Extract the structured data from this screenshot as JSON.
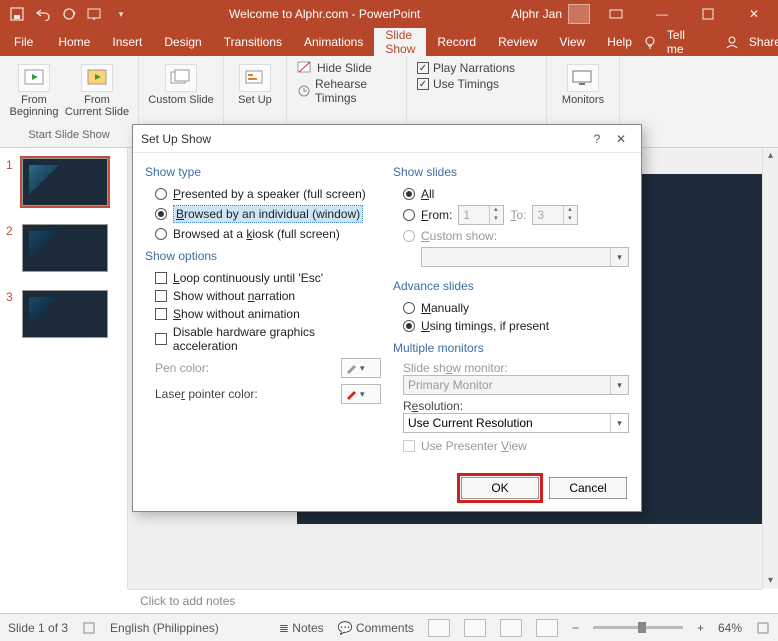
{
  "titlebar": {
    "doc_title": "Welcome to Alphr.com - PowerPoint",
    "user": "Alphr Jan"
  },
  "ribbon": {
    "tabs": [
      "File",
      "Home",
      "Insert",
      "Design",
      "Transitions",
      "Animations",
      "Slide Show",
      "Record",
      "Review",
      "View",
      "Help"
    ],
    "active": "Slide Show",
    "tell_me": "Tell me",
    "share": "Share",
    "group_start": "Start Slide Show",
    "from_beginning": "From\nBeginning",
    "from_current": "From\nCurrent Slide",
    "custom_slide": "Custom Slide",
    "setup": "Set Up",
    "hide_slide": "Hide Slide",
    "rehearse": "Rehearse Timings",
    "play_narr": "Play Narrations",
    "use_timings": "Use Timings",
    "monitors": "Monitors"
  },
  "dlg": {
    "title": "Set Up Show",
    "show_type": "Show type",
    "presented": "Presented by a speaker (full screen)",
    "browsed_ind": "Browsed by an individual (window)",
    "browsed_kiosk": "Browsed at a kiosk (full screen)",
    "show_options": "Show options",
    "loop": "Loop continuously until 'Esc'",
    "no_narr": "Show without narration",
    "no_anim": "Show without animation",
    "disable_hw": "Disable hardware graphics acceleration",
    "pen_color": "Pen color:",
    "laser_color": "Laser pointer color:",
    "show_slides": "Show slides",
    "all": "All",
    "from": "From:",
    "from_val": "1",
    "to": "To:",
    "to_val": "3",
    "custom_show": "Custom show:",
    "advance": "Advance slides",
    "manually": "Manually",
    "using_timings": "Using timings, if present",
    "multi_mon": "Multiple monitors",
    "mon_label": "Slide show monitor:",
    "mon_val": "Primary Monitor",
    "res_label": "Resolution:",
    "res_val": "Use Current Resolution",
    "presenter_view": "Use Presenter View",
    "ok": "OK",
    "cancel": "Cancel"
  },
  "notes": {
    "placeholder": "Click to add notes"
  },
  "status": {
    "slide": "Slide 1 of 3",
    "lang": "English (Philippines)",
    "notes": "Notes",
    "comments": "Comments",
    "zoom": "64%"
  },
  "thumbs": [
    "1",
    "2",
    "3"
  ]
}
